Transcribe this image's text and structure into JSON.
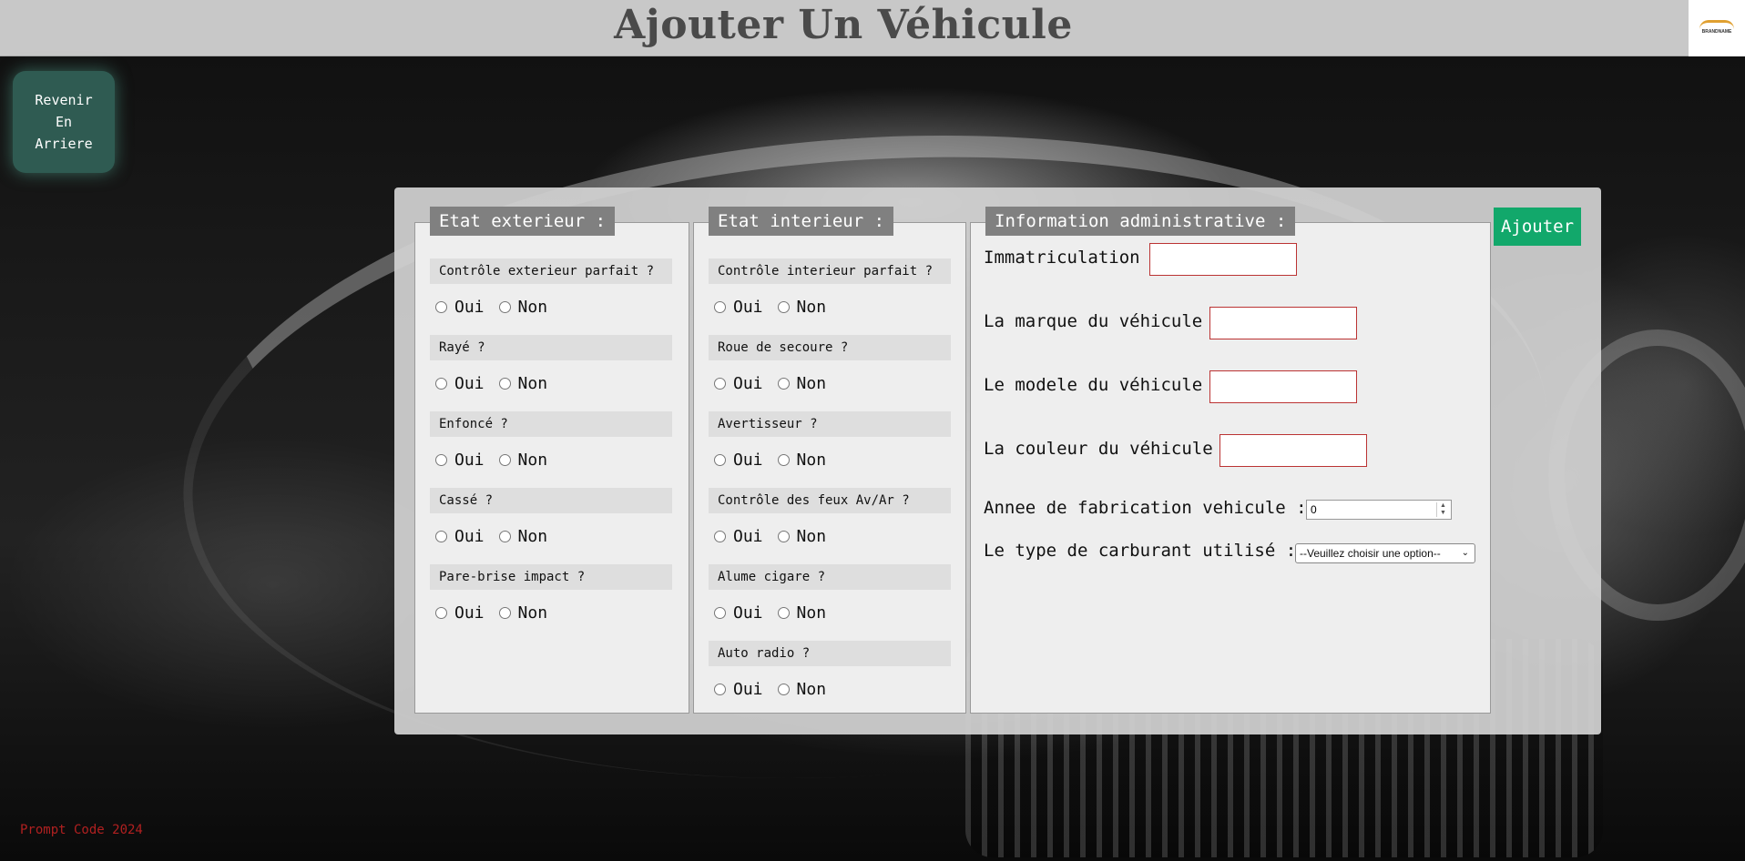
{
  "header": {
    "title": "Ajouter Un Véhicule",
    "logo_text": "BRANDNAME"
  },
  "back_button": {
    "lines": [
      "Revenir",
      "En",
      "Arriere"
    ]
  },
  "exterior": {
    "legend": "Etat exterieur :",
    "questions": [
      {
        "label": "Contrôle exterieur parfait ?",
        "yes": "Oui",
        "no": "Non"
      },
      {
        "label": "Rayé ?",
        "yes": "Oui",
        "no": "Non"
      },
      {
        "label": "Enfoncé ?",
        "yes": "Oui",
        "no": "Non"
      },
      {
        "label": "Cassé ?",
        "yes": "Oui",
        "no": "Non"
      },
      {
        "label": "Pare-brise impact ?",
        "yes": "Oui",
        "no": "Non"
      }
    ]
  },
  "interior": {
    "legend": "Etat interieur :",
    "questions": [
      {
        "label": "Contrôle interieur parfait ?",
        "yes": "Oui",
        "no": "Non"
      },
      {
        "label": "Roue de secoure ?",
        "yes": "Oui",
        "no": "Non"
      },
      {
        "label": "Avertisseur ?",
        "yes": "Oui",
        "no": "Non"
      },
      {
        "label": "Contrôle des feux Av/Ar ?",
        "yes": "Oui",
        "no": "Non"
      },
      {
        "label": "Alume cigare ?",
        "yes": "Oui",
        "no": "Non"
      },
      {
        "label": "Auto radio ?",
        "yes": "Oui",
        "no": "Non"
      }
    ]
  },
  "admin": {
    "legend": "Information administrative :",
    "immatriculation_label": "Immatriculation :",
    "immatriculation_value": "",
    "marque_label": "La marque du véhicule :",
    "marque_value": "",
    "modele_label": "Le modele du véhicule :",
    "modele_value": "",
    "couleur_label": "La couleur du véhicule :",
    "couleur_value": "",
    "annee_label": "Annee de fabrication vehicule :",
    "annee_value": "0",
    "carburant_label": "Le type de carburant utilisé :",
    "carburant_selected": "--Veuillez choisir une option--"
  },
  "add_button_label": "Ajouter",
  "footer_text": "Prompt Code 2024",
  "colors": {
    "header_bg": "#c8c8c8",
    "back_button_bg": "#2f5b52",
    "add_button_bg": "#12a86b",
    "legend_bg": "#808080",
    "footer_text": "#b02020"
  }
}
